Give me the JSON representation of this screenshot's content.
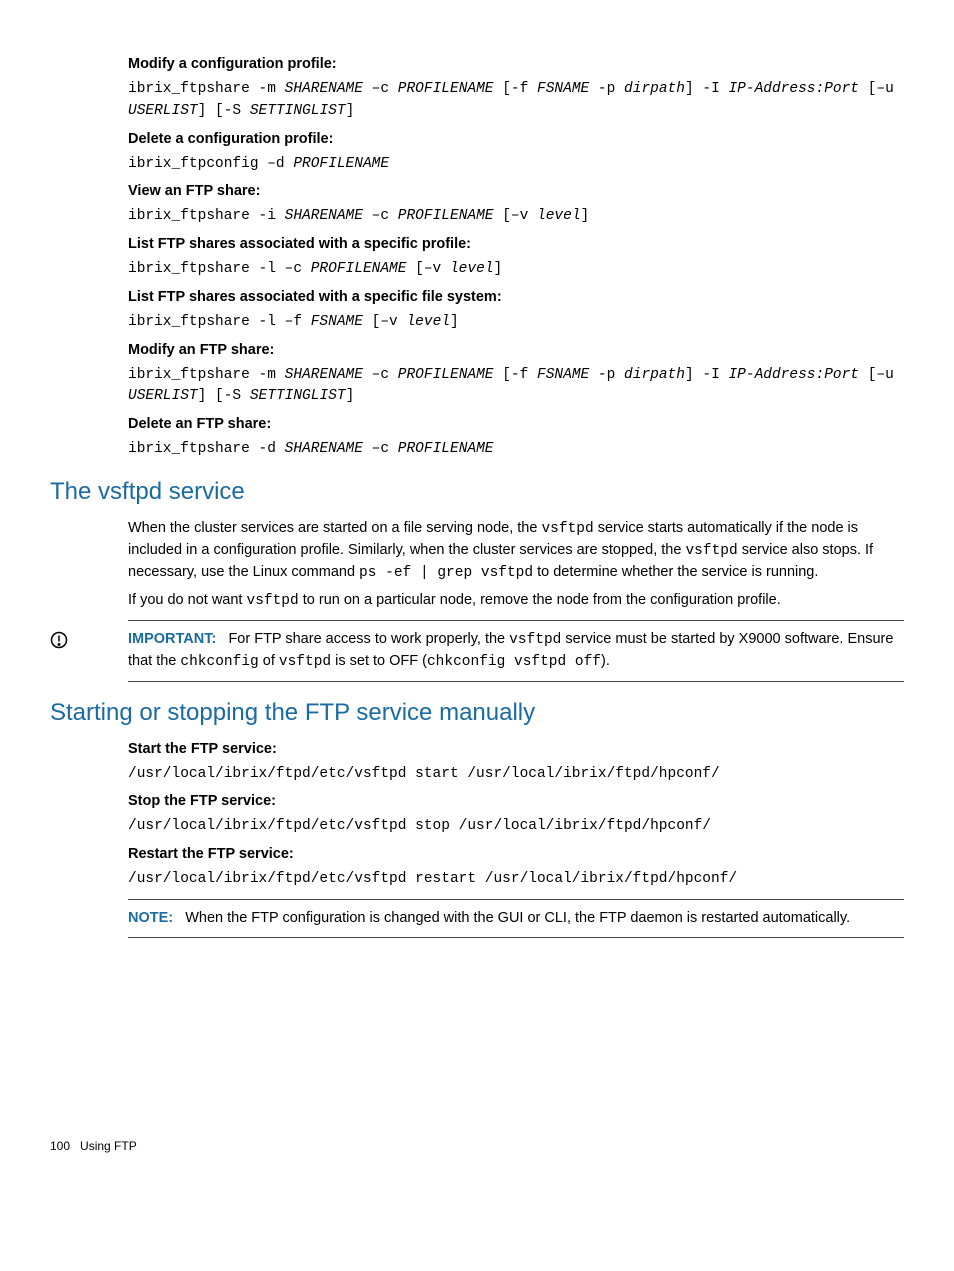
{
  "s1": {
    "h1": "Modify a configuration profile:",
    "c1a": "ibrix_ftpshare -m ",
    "c1b": "SHARENAME",
    "c1c": " –c ",
    "c1d": "PROFILENAME",
    "c1e": " [-f ",
    "c1f": "FSNAME",
    "c1g": " -p ",
    "c1h": "dirpath",
    "c1i": "] -I ",
    "c1j": "IP-Address:Port",
    "c1k": " [–u ",
    "c1l": "USERLIST",
    "c1m": "] [-S ",
    "c1n": "SETTINGLIST",
    "c1o": "]",
    "h2": "Delete a configuration profile:",
    "c2a": "ibrix_ftpconfig –d ",
    "c2b": "PROFILENAME",
    "h3": "View an FTP share:",
    "c3a": "ibrix_ftpshare -i ",
    "c3b": "SHARENAME",
    "c3c": " –c ",
    "c3d": "PROFILENAME",
    "c3e": " [–v ",
    "c3f": "level",
    "c3g": "]",
    "h4": "List FTP shares associated with a specific profile:",
    "c4a": "ibrix_ftpshare -l –c ",
    "c4b": "PROFILENAME",
    "c4c": " [–v ",
    "c4d": "level",
    "c4e": "]",
    "h5": "List FTP shares associated with a specific file system:",
    "c5a": "ibrix_ftpshare -l –f ",
    "c5b": "FSNAME",
    "c5c": " [–v ",
    "c5d": "level",
    "c5e": "]",
    "h6": "Modify an FTP share:",
    "c6a": "ibrix_ftpshare -m ",
    "c6b": "SHARENAME",
    "c6c": " –c ",
    "c6d": "PROFILENAME",
    "c6e": " [-f ",
    "c6f": "FSNAME",
    "c6g": " -p ",
    "c6h": "dirpath",
    "c6i": "] -I ",
    "c6j": "IP-Address:Port",
    "c6k": " [–u ",
    "c6l": "USERLIST",
    "c6m": "] [-S ",
    "c6n": "SETTINGLIST",
    "c6o": "]",
    "h7": "Delete an FTP share:",
    "c7a": "ibrix_ftpshare -d ",
    "c7b": "SHARENAME",
    "c7c": " –c ",
    "c7d": "PROFILENAME"
  },
  "s2": {
    "title": "The vsftpd service",
    "p1a": "When the cluster services are started on a file serving node, the ",
    "p1b": "vsftpd",
    "p1c": " service starts automatically if the node is included in a configuration profile. Similarly, when the cluster services are stopped, the ",
    "p1d": "vsftpd",
    "p1e": " service also stops. If necessary, use the Linux command ",
    "p1f": "ps -ef | grep vsftpd",
    "p1g": " to determine whether the service is running.",
    "p2a": "If you do not want ",
    "p2b": "vsftpd",
    "p2c": " to run on a particular node, remove the node from the configuration profile.",
    "imp_label": "IMPORTANT:",
    "imp_a": "For FTP share access to work properly, the ",
    "imp_b": "vsftpd",
    "imp_c": " service must be started by X9000 software. Ensure that the ",
    "imp_d": "chkconfig",
    "imp_e": " of ",
    "imp_f": "vsftpd",
    "imp_g": " is set to OFF (",
    "imp_h": "chkconfig vsftpd off",
    "imp_i": ")."
  },
  "s3": {
    "title": "Starting or stopping the FTP service manually",
    "h1": "Start the FTP service:",
    "c1": "/usr/local/ibrix/ftpd/etc/vsftpd start /usr/local/ibrix/ftpd/hpconf/",
    "h2": "Stop the FTP service:",
    "c2": "/usr/local/ibrix/ftpd/etc/vsftpd stop /usr/local/ibrix/ftpd/hpconf/",
    "h3": "Restart the FTP service:",
    "c3": "/usr/local/ibrix/ftpd/etc/vsftpd restart /usr/local/ibrix/ftpd/hpconf/",
    "note_label": "NOTE:",
    "note_text": "When the FTP configuration is changed with the GUI or CLI, the FTP daemon is restarted automatically."
  },
  "footer": {
    "page": "100",
    "title": "Using FTP"
  }
}
